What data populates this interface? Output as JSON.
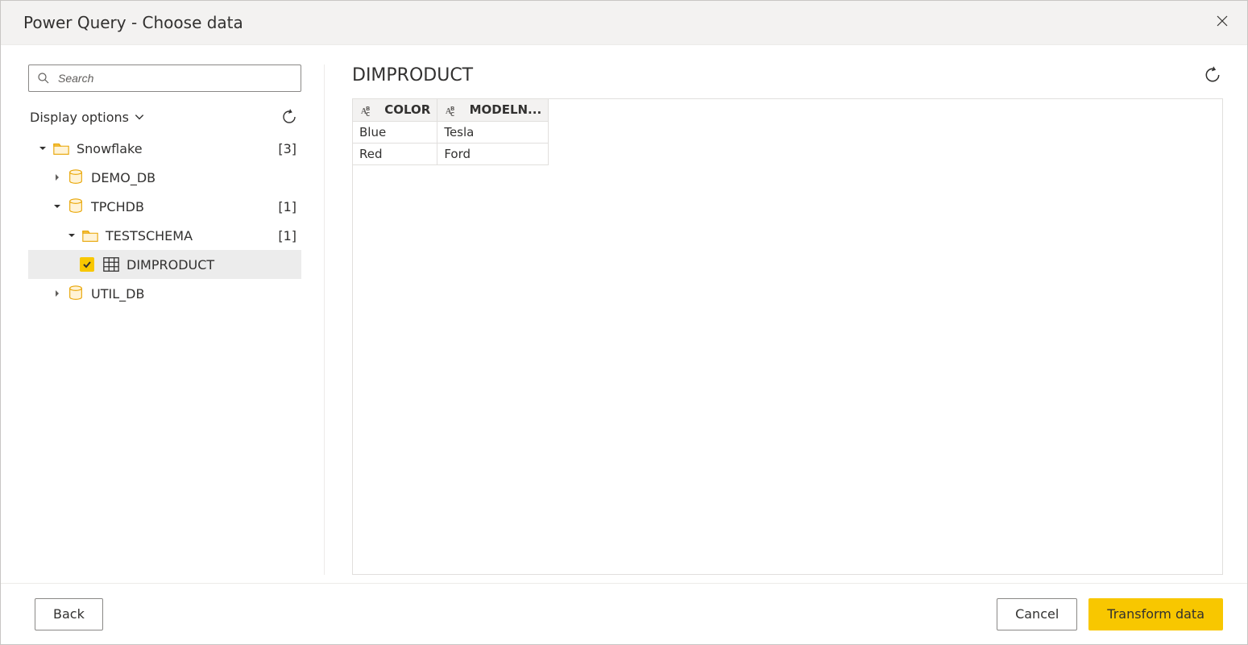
{
  "window": {
    "title": "Power Query - Choose data"
  },
  "sidebar": {
    "search_placeholder": "Search",
    "display_options_label": "Display options",
    "root": {
      "name": "Snowflake",
      "count": "[3]"
    },
    "db_demo": "DEMO_DB",
    "db_tpch": {
      "name": "TPCHDB",
      "count": "[1]"
    },
    "schema_test": {
      "name": "TESTSCHEMA",
      "count": "[1]"
    },
    "table_dimproduct": "DIMPRODUCT",
    "db_util": "UTIL_DB"
  },
  "preview": {
    "title": "DIMPRODUCT",
    "columns": [
      "COLOR",
      "MODELN..."
    ],
    "rows": [
      {
        "c0": "Blue",
        "c1": "Tesla"
      },
      {
        "c0": "Red",
        "c1": "Ford"
      }
    ]
  },
  "footer": {
    "back": "Back",
    "cancel": "Cancel",
    "transform": "Transform data"
  }
}
